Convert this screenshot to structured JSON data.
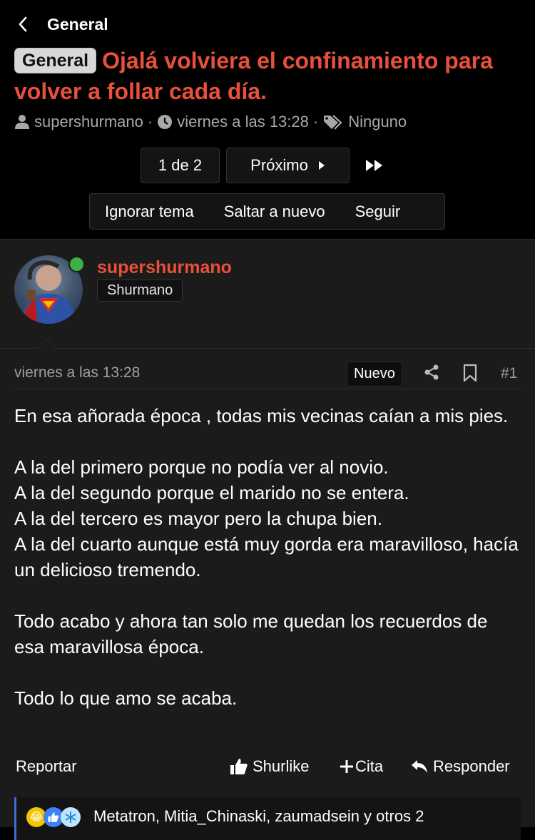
{
  "nav": {
    "back_label": "General"
  },
  "thread": {
    "prefix": "General",
    "title": "Ojalá volviera el confinamiento para volver a follar cada día.",
    "author": "supershurmano",
    "date": "viernes a las 13:28",
    "tags": "Ninguno"
  },
  "pager": {
    "page": "1 de 2",
    "next": "Próximo"
  },
  "thread_actions": {
    "ignore": "Ignorar tema",
    "jump_new": "Saltar a nuevo",
    "follow": "Seguir"
  },
  "post": {
    "username": "supershurmano",
    "user_title": "Shurmano",
    "date": "viernes a las 13:28",
    "new_badge": "Nuevo",
    "number": "#1",
    "paragraphs": [
      "En esa añorada época , todas mis vecinas caían a mis pies.",
      "A la del primero porque no podía ver al novio.\nA la del segundo porque el marido no se entera.\nA la del tercero es mayor pero la chupa bien.\nA la del cuarto aunque está muy gorda era maravilloso, hacía un delicioso tremendo.",
      "Todo acabo y ahora tan solo me quedan los recuerdos de esa maravillosa época.",
      "Todo lo que amo se acaba."
    ]
  },
  "post_actions": {
    "report": "Reportar",
    "like": "Shurlike",
    "quote": "Cita",
    "reply": "Responder"
  },
  "reactions": {
    "text": "Metatron, Mitia_Chinaski, zaumadsein y otros 2"
  },
  "colors": {
    "accent": "#e8503a",
    "online": "#3cb043",
    "reaction_bar": "#3d6fd0"
  }
}
